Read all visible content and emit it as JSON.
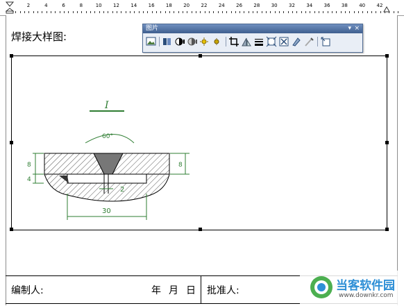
{
  "ruler": {
    "numbers": [
      "2",
      "4",
      "6",
      "8",
      "10",
      "12",
      "14",
      "16",
      "18",
      "20",
      "22",
      "24",
      "26",
      "28",
      "30",
      "32",
      "34",
      "36",
      "38",
      "40",
      "42"
    ]
  },
  "document": {
    "heading": "焊接大样图:",
    "footer": {
      "editor_label": "编制人:",
      "year": "年",
      "month": "月",
      "day": "日",
      "approver_label": "批准人:"
    }
  },
  "picture_toolbar": {
    "title": "图片",
    "dropdown_glyph": "▾",
    "close_glyph": "×",
    "buttons": [
      "insert-picture-icon",
      "color-icon",
      "more-contrast-icon",
      "less-contrast-icon",
      "more-brightness-icon",
      "less-brightness-icon",
      "crop-icon",
      "rotate-icon",
      "line-style-icon",
      "compress-icon",
      "text-wrapping-icon",
      "format-picture-icon",
      "set-transparent-color-icon",
      "reset-picture-icon"
    ]
  },
  "drawing": {
    "detail_label": "I",
    "angle_label": "60°",
    "dim_left_top": "8",
    "dim_left_bottom": "4",
    "dim_right": "8",
    "gap_label": "2",
    "width_label": "30"
  },
  "watermark": {
    "brand": "当客软件园",
    "url": "www.downkr.com"
  },
  "colors": {
    "dimension_green": "#2e7d32",
    "title_bar_blue": "#4a6aa0",
    "brand_blue": "#2e8fd6"
  }
}
